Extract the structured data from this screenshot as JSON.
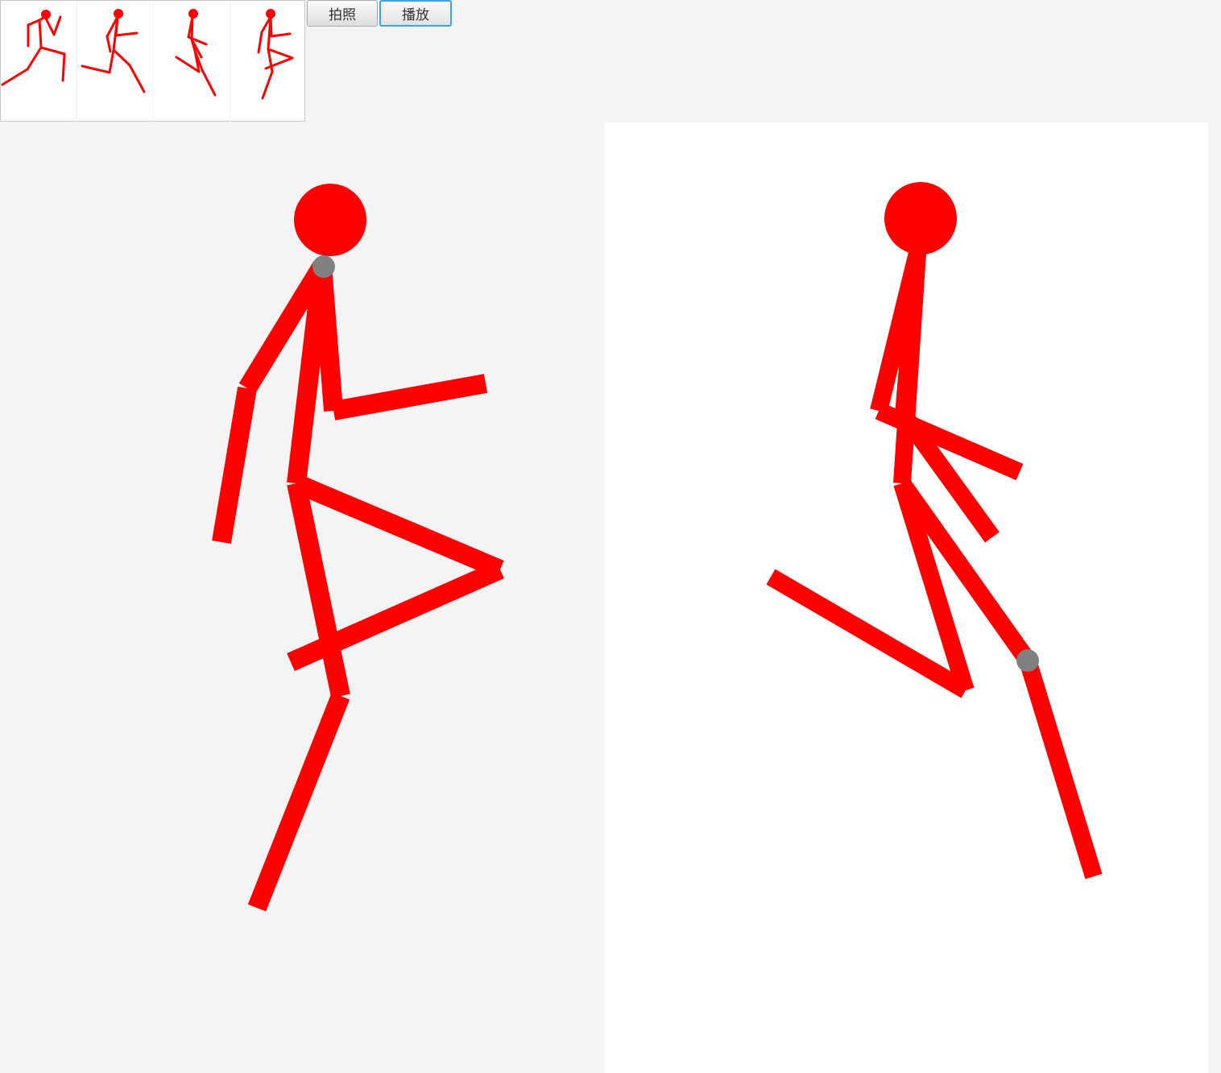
{
  "toolbar": {
    "capture_label": "拍照",
    "play_label": "播放"
  },
  "colors": {
    "figure": "#ff0000",
    "handle": "#808080",
    "panel_bg": "#f4f4f4",
    "canvas_bg": "#ffffff",
    "focus_border": "#3aa6e0"
  },
  "icons": {
    "capture": "camera-icon",
    "play": "play-icon"
  }
}
